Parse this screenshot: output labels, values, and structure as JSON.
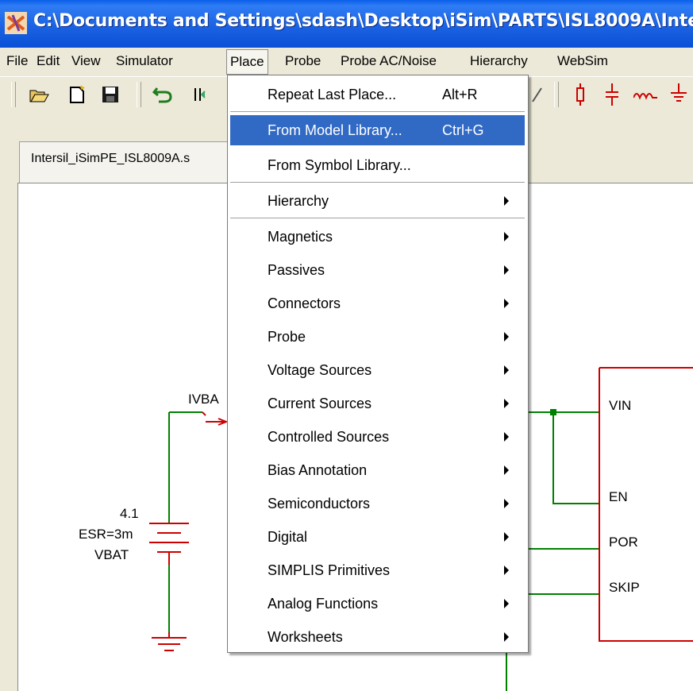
{
  "window": {
    "title": "C:\\Documents and Settings\\sdash\\Desktop\\iSim\\PARTS\\ISL8009A\\Inte"
  },
  "menubar": {
    "items": [
      "File",
      "Edit",
      "View",
      "Simulator",
      "Place",
      "Probe",
      "Probe AC/Noise",
      "Hierarchy",
      "WebSim"
    ],
    "active": "Place"
  },
  "toolbar": {
    "buttons": [
      "open-folder-icon",
      "new-file-icon",
      "save-icon",
      "undo-icon",
      "flip-icon",
      "pen-icon",
      "diode-icon",
      "capacitor-icon",
      "inductor-icon",
      "ground-icon"
    ]
  },
  "document": {
    "tab_label": "Intersil_iSimPE_ISL8009A.s"
  },
  "place_menu": {
    "items": [
      {
        "label": "Repeat Last Place...",
        "shortcut": "Alt+R"
      },
      {
        "label": "From Model Library...",
        "shortcut": "Ctrl+G",
        "highlighted": true
      },
      {
        "label": "From Symbol Library...",
        "shortcut": ""
      },
      {
        "label": "Hierarchy",
        "submenu": true
      },
      {
        "label": "Magnetics",
        "submenu": true
      },
      {
        "label": "Passives",
        "submenu": true
      },
      {
        "label": "Connectors",
        "submenu": true
      },
      {
        "label": "Probe",
        "submenu": true
      },
      {
        "label": "Voltage Sources",
        "submenu": true
      },
      {
        "label": "Current Sources",
        "submenu": true
      },
      {
        "label": "Controlled Sources",
        "submenu": true
      },
      {
        "label": "Bias Annotation",
        "submenu": true
      },
      {
        "label": "Semiconductors",
        "submenu": true
      },
      {
        "label": "Digital",
        "submenu": true
      },
      {
        "label": "SIMPLIS Primitives",
        "submenu": true
      },
      {
        "label": "Analog Functions",
        "submenu": true
      },
      {
        "label": "Worksheets",
        "submenu": true
      }
    ]
  },
  "schematic": {
    "probe_label": "IVBA",
    "battery_value": "4.1",
    "battery_esr": "ESR=3m",
    "battery_name": "VBAT",
    "pins": [
      "VIN",
      "EN",
      "POR",
      "SKIP"
    ],
    "wire_color": "#008000",
    "component_color": "#cc0000"
  },
  "colors": {
    "title_bar": "#0a4fd6",
    "menu_highlight": "#316ac5",
    "chrome": "#ece9d8"
  }
}
